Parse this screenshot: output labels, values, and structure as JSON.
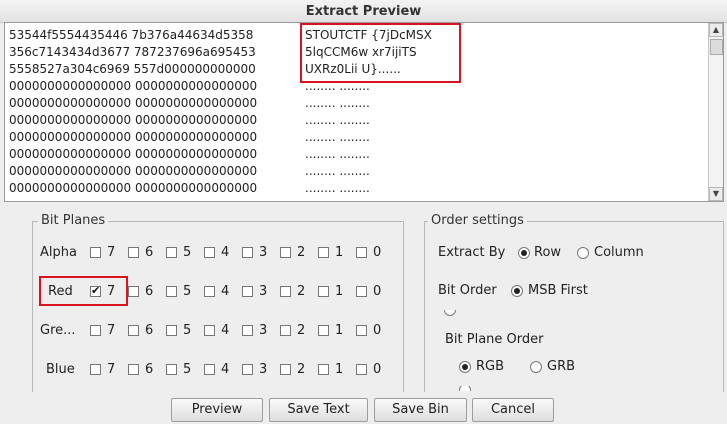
{
  "window": {
    "title": "Extract Preview"
  },
  "preview": {
    "rows": [
      {
        "hex": "53544f5554435446 7b376a44634d5358",
        "ascii": "STOUTCTF {7jDcMSX"
      },
      {
        "hex": "356c7143434d3677 787237696a695453",
        "ascii": "5lqCCM6w xr7ijiTS"
      },
      {
        "hex": "5558527a304c6969 557d000000000000",
        "ascii": "UXRz0Lii U}......"
      },
      {
        "hex": "0000000000000000 0000000000000000",
        "ascii": "........ ........"
      },
      {
        "hex": "0000000000000000 0000000000000000",
        "ascii": "........ ........"
      },
      {
        "hex": "0000000000000000 0000000000000000",
        "ascii": "........ ........"
      },
      {
        "hex": "0000000000000000 0000000000000000",
        "ascii": "........ ........"
      },
      {
        "hex": "0000000000000000 0000000000000000",
        "ascii": "........ ........"
      },
      {
        "hex": "0000000000000000 0000000000000000",
        "ascii": "........ ........"
      },
      {
        "hex": "0000000000000000 0000000000000000",
        "ascii": "........ ........"
      }
    ]
  },
  "bit_planes": {
    "title": "Bit Planes",
    "bits": [
      "7",
      "6",
      "5",
      "4",
      "3",
      "2",
      "1",
      "0"
    ],
    "channels": [
      {
        "label": "Alpha",
        "checked": []
      },
      {
        "label": "Red",
        "checked": [
          "7"
        ]
      },
      {
        "label": "Gre...",
        "checked": []
      },
      {
        "label": "Blue",
        "checked": []
      }
    ]
  },
  "order": {
    "title": "Order settings",
    "extract_by": {
      "label": "Extract By",
      "options": [
        "Row",
        "Column"
      ],
      "selected": "Row"
    },
    "bit_order": {
      "label": "Bit Order",
      "options": [
        "MSB First"
      ],
      "selected": "MSB First"
    },
    "plane_order": {
      "label": "Bit Plane Order",
      "options": [
        "RGB",
        "GRB"
      ],
      "selected": "RGB"
    }
  },
  "buttons": {
    "preview": "Preview",
    "save_text": "Save Text",
    "save_bin": "Save Bin",
    "cancel": "Cancel"
  },
  "colors": {
    "highlight": "#d9131f"
  }
}
